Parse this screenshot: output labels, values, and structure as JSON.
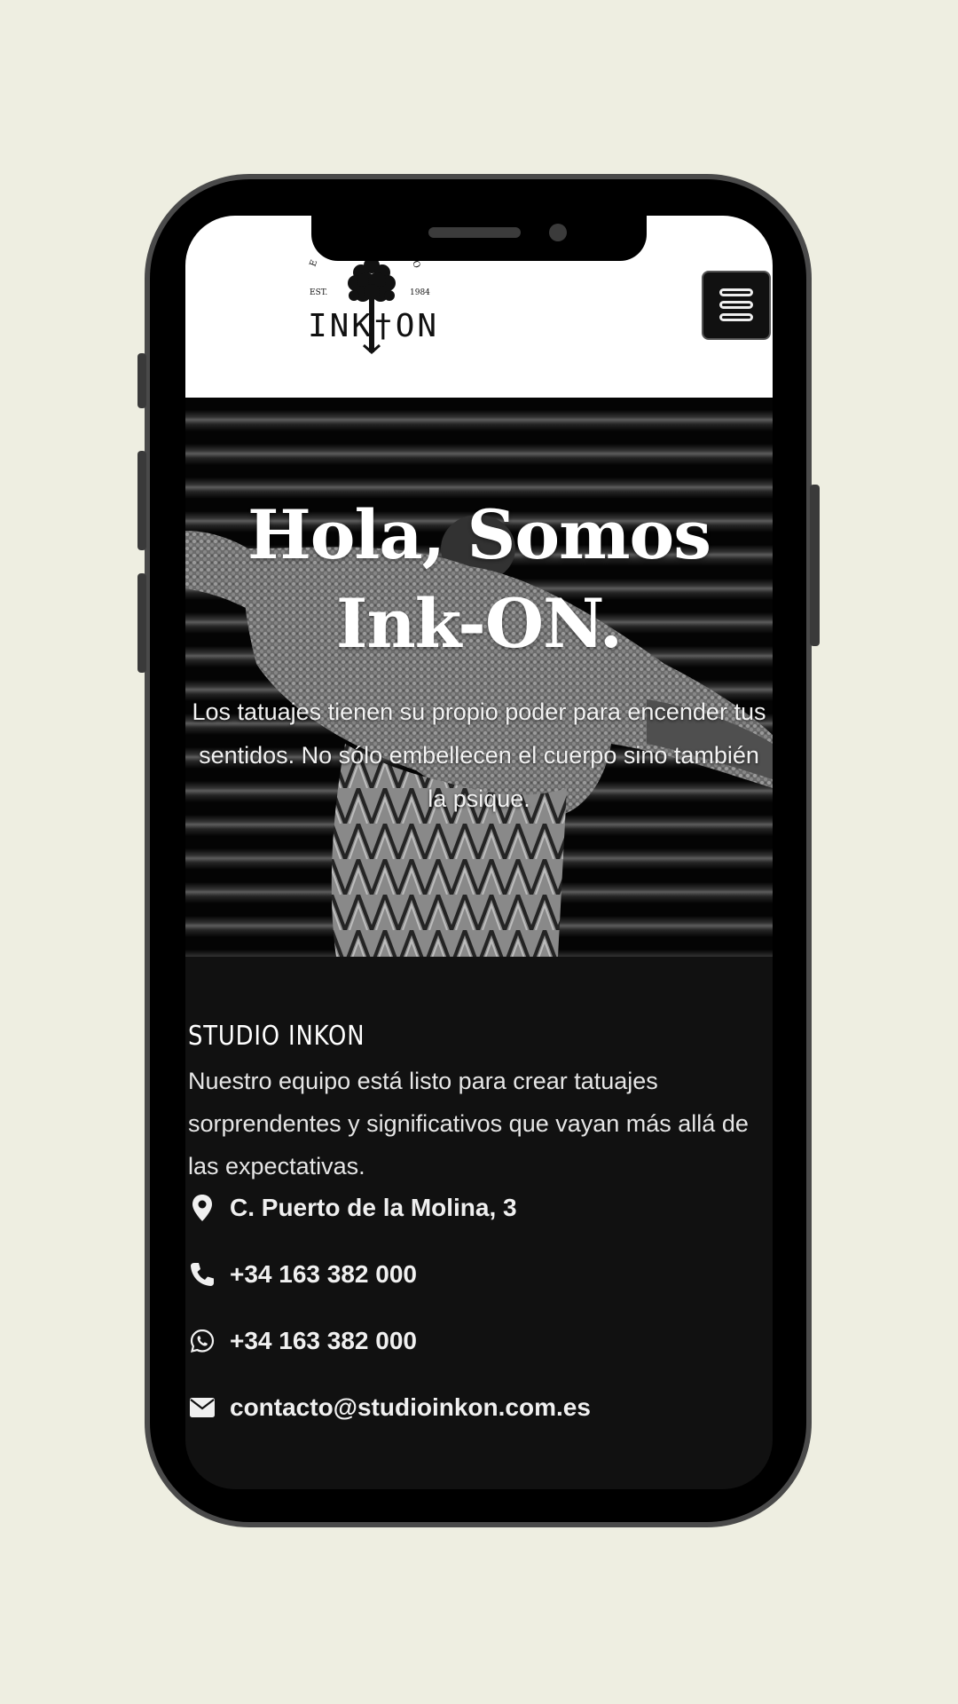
{
  "header": {
    "logo_text": "INK†ON",
    "logo_est": "EST.",
    "logo_year": "1984",
    "menu_button_icon": "hamburger-menu-icon"
  },
  "hero": {
    "title_line1": "Hola, Somos",
    "title_line2": "Ink-ON.",
    "text": "Los tatuajes tienen su propio poder para encender tus sentidos. No sólo embellecen el cuerpo sino también la psique."
  },
  "info": {
    "title": "STUDIO INKON",
    "description": "Nuestro equipo está listo para crear tatuajes sorprendentes y significativos que vayan más allá de las expectativas."
  },
  "contacts": [
    {
      "icon": "map-pin-icon",
      "text": "C. Puerto de la Molina, 3"
    },
    {
      "icon": "phone-icon",
      "text": "+34 163 382 000"
    },
    {
      "icon": "whatsapp-icon",
      "text": "+34 163 382 000"
    },
    {
      "icon": "envelope-icon",
      "text": "contacto@studioinkon.com.es"
    }
  ],
  "colors": {
    "page_background": "#eeeee1",
    "phone_frame": "#4a4a4a",
    "section_dark": "#111111",
    "text_light": "#ffffff"
  }
}
